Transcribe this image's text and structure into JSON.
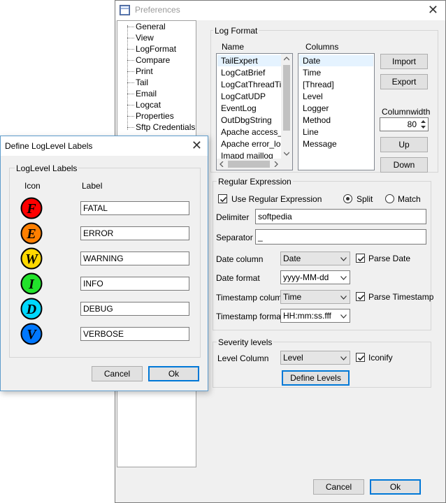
{
  "preferences": {
    "title": "Preferences",
    "tree_items": [
      "General",
      "View",
      "LogFormat",
      "Compare",
      "Print",
      "Tail",
      "Email",
      "Logcat",
      "Properties",
      "Sftp Credentials"
    ],
    "log_format": {
      "label": "Log Format",
      "name_header": "Name",
      "columns_header": "Columns",
      "names": [
        "TailExpert",
        "LogCatBrief",
        "LogCatThreadTim",
        "LogCatUDP",
        "EventLog",
        "OutDbgString",
        "Apache access_lo",
        "Apache error_log",
        "Imapd maillog"
      ],
      "columns": [
        "Date",
        "Time",
        "[Thread]",
        "Level",
        "Logger",
        "Method",
        "Line",
        "Message"
      ],
      "import_label": "Import",
      "export_label": "Export",
      "columnwidth_label": "Columnwidth",
      "columnwidth_value": "80",
      "up_label": "Up",
      "down_label": "Down"
    },
    "regex": {
      "label": "Regular Expression",
      "use_regex_label": "Use Regular Expression",
      "split_label": "Split",
      "match_label": "Match",
      "delimiter_label": "Delimiter",
      "delimiter_value": "softpedia",
      "separator_label": "Separator",
      "separator_value": "_",
      "date_column_label": "Date column",
      "date_column_value": "Date",
      "parse_date_label": "Parse Date",
      "date_format_label": "Date format",
      "date_format_value": "yyyy-MM-dd",
      "timestamp_column_label": "Timestamp column",
      "timestamp_column_value": "Time",
      "parse_timestamp_label": "Parse Timestamp",
      "timestamp_format_label": "Timestamp format",
      "timestamp_format_value": "HH:mm:ss.fff"
    },
    "severity": {
      "label": "Severity levels",
      "level_column_label": "Level Column",
      "level_column_value": "Level",
      "iconify_label": "Iconify",
      "define_levels_label": "Define Levels"
    },
    "cancel_label": "Cancel",
    "ok_label": "Ok"
  },
  "dialog": {
    "title": "Define LogLevel Labels",
    "group_label": "LogLevel Labels",
    "icon_header": "Icon",
    "label_header": "Label",
    "levels": [
      {
        "letter": "F",
        "label": "FATAL",
        "color": "#ff0000"
      },
      {
        "letter": "E",
        "label": "ERROR",
        "color": "#ff7f00"
      },
      {
        "letter": "W",
        "label": "WARNING",
        "color": "#ffd800"
      },
      {
        "letter": "I",
        "label": "INFO",
        "color": "#22e32b"
      },
      {
        "letter": "D",
        "label": "DEBUG",
        "color": "#00d7ff"
      },
      {
        "letter": "V",
        "label": "VERBOSE",
        "color": "#0078ff"
      }
    ],
    "cancel_label": "Cancel",
    "ok_label": "Ok"
  },
  "colors": {
    "accent": "#0078d7",
    "selection": "#e5f3ff"
  }
}
